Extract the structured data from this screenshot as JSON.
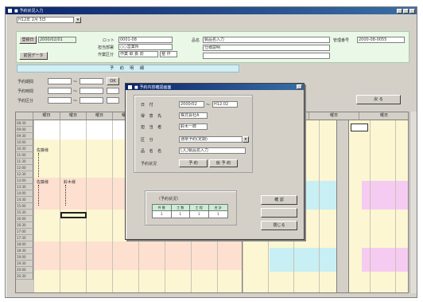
{
  "window": {
    "title": "■ 予約状況入力",
    "date_value": "H12年 2月 5日"
  },
  "header": {
    "left_button_1": "登録日",
    "left_field_1": "2000/02/01",
    "label_a": "ロット",
    "field_a": "0001-08",
    "label_b": "担当部署",
    "field_b": "○○営業所",
    "label_c": "作業区分",
    "field_c": "作業 取 扱 前",
    "field_c2": "整 作",
    "left_button_2": "前回データ",
    "label_d": "品名",
    "field_d": "製品名入力",
    "field_e": "仕様説明",
    "label_right": "管理番号",
    "field_right": "2000-08-0055"
  },
  "section_band": "予 約 明 細",
  "filters": {
    "row1_label": "予約期間",
    "row2_label": "予約時間",
    "row3_label": "予約区分",
    "from1": "",
    "to1": "",
    "from2": "",
    "to2": "",
    "from3": "",
    "to3": "",
    "ok_label": "OK",
    "right_btn": "戻  る"
  },
  "grid": {
    "columns": [
      "曜日",
      "曜日",
      "曜日",
      "曜日",
      "曜日",
      "曜日",
      "曜日",
      "曜日",
      "曜日",
      "曜日",
      "曜日",
      "曜日"
    ],
    "row_labels": [
      "08:30",
      "09:00",
      "09:30",
      "10:00",
      "10:30",
      "11:00",
      "11:30",
      "12:00",
      "12:30",
      "13:00",
      "13:30",
      "14:00",
      "14:30",
      "15:00",
      "15:30",
      "16:00",
      "16:30",
      "17:00",
      "17:30",
      "18:00",
      "18:30",
      "19:00",
      "19:30",
      "20:00",
      "20:30"
    ],
    "booking_1": "佐藤様",
    "booking_2": "佐藤様",
    "booking_3": "鈴木様"
  },
  "dialog": {
    "title": "■ 予約内容確認画面",
    "date_label": "日 付",
    "date_from": "2000/02",
    "date_to": "H12.02",
    "customer_label": "得 意 先",
    "customer_value": "株式会社A",
    "member_label": "担 当 者",
    "member_value": "鈴木一郎",
    "category_label": "区 分",
    "category_value": "通常予約(定期)",
    "item_label": "品 名 名",
    "item_value": "〇〇製品名入力",
    "reserve_label": "予約状況",
    "reserve_opt1": "予 約",
    "reserve_opt2": "仮 予 約",
    "summary_title": "〔予約状況〕",
    "summary_cols": [
      "件 数",
      "工 数",
      "工 程",
      "合 計"
    ],
    "summary_vals": [
      "1",
      "1",
      "1",
      "1"
    ],
    "btn_ok": "確 認",
    "btn_mid": "",
    "btn_close": "閉じる"
  },
  "colors": {
    "booking_peach": "#fde0cf",
    "booking_yellow": "#fcf7d2",
    "cyan_band": "#c8eff4",
    "pink_band": "#f6cbf1",
    "green_field": "#e4f7e0"
  }
}
